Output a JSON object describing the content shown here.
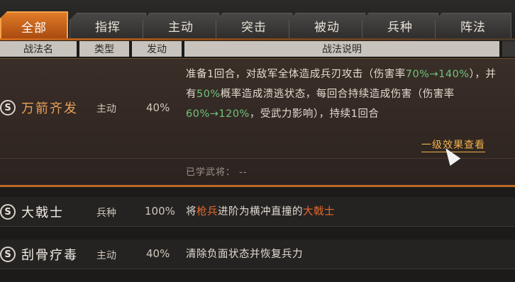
{
  "tabs": [
    "全部",
    "指挥",
    "主动",
    "突击",
    "被动",
    "兵种",
    "阵法"
  ],
  "headers": {
    "name": "战法名",
    "type": "类型",
    "rate": "发动",
    "desc": "战法说明"
  },
  "rows": [
    {
      "icon": "S",
      "name": "万箭齐发",
      "type": "主动",
      "rate": "40%",
      "desc_parts": [
        {
          "t": "准备1回合，对敌军全体造成兵刃攻击（伤害率"
        },
        {
          "t": "70%→140%",
          "c": "g"
        },
        {
          "t": "），并有"
        },
        {
          "t": "50%",
          "c": "g"
        },
        {
          "t": "概率造成溃逃状态，每回合持续造成伤害（伤害率"
        },
        {
          "t": "60%→120%",
          "c": "g"
        },
        {
          "t": "，受武力影响），持续1回合"
        }
      ],
      "view_effect": "一级效果查看",
      "learned": "已学武将：  --"
    },
    {
      "icon": "S",
      "name": "大戟士",
      "type": "兵种",
      "rate": "100%",
      "desc_parts": [
        {
          "t": "将"
        },
        {
          "t": "枪兵",
          "c": "o"
        },
        {
          "t": "进阶为横冲直撞的"
        },
        {
          "t": "大戟士",
          "c": "o"
        }
      ]
    },
    {
      "icon": "S",
      "name": "刮骨疗毒",
      "type": "主动",
      "rate": "40%",
      "desc_parts": [
        {
          "t": "清除负面状态并恢复兵力"
        }
      ]
    }
  ]
}
